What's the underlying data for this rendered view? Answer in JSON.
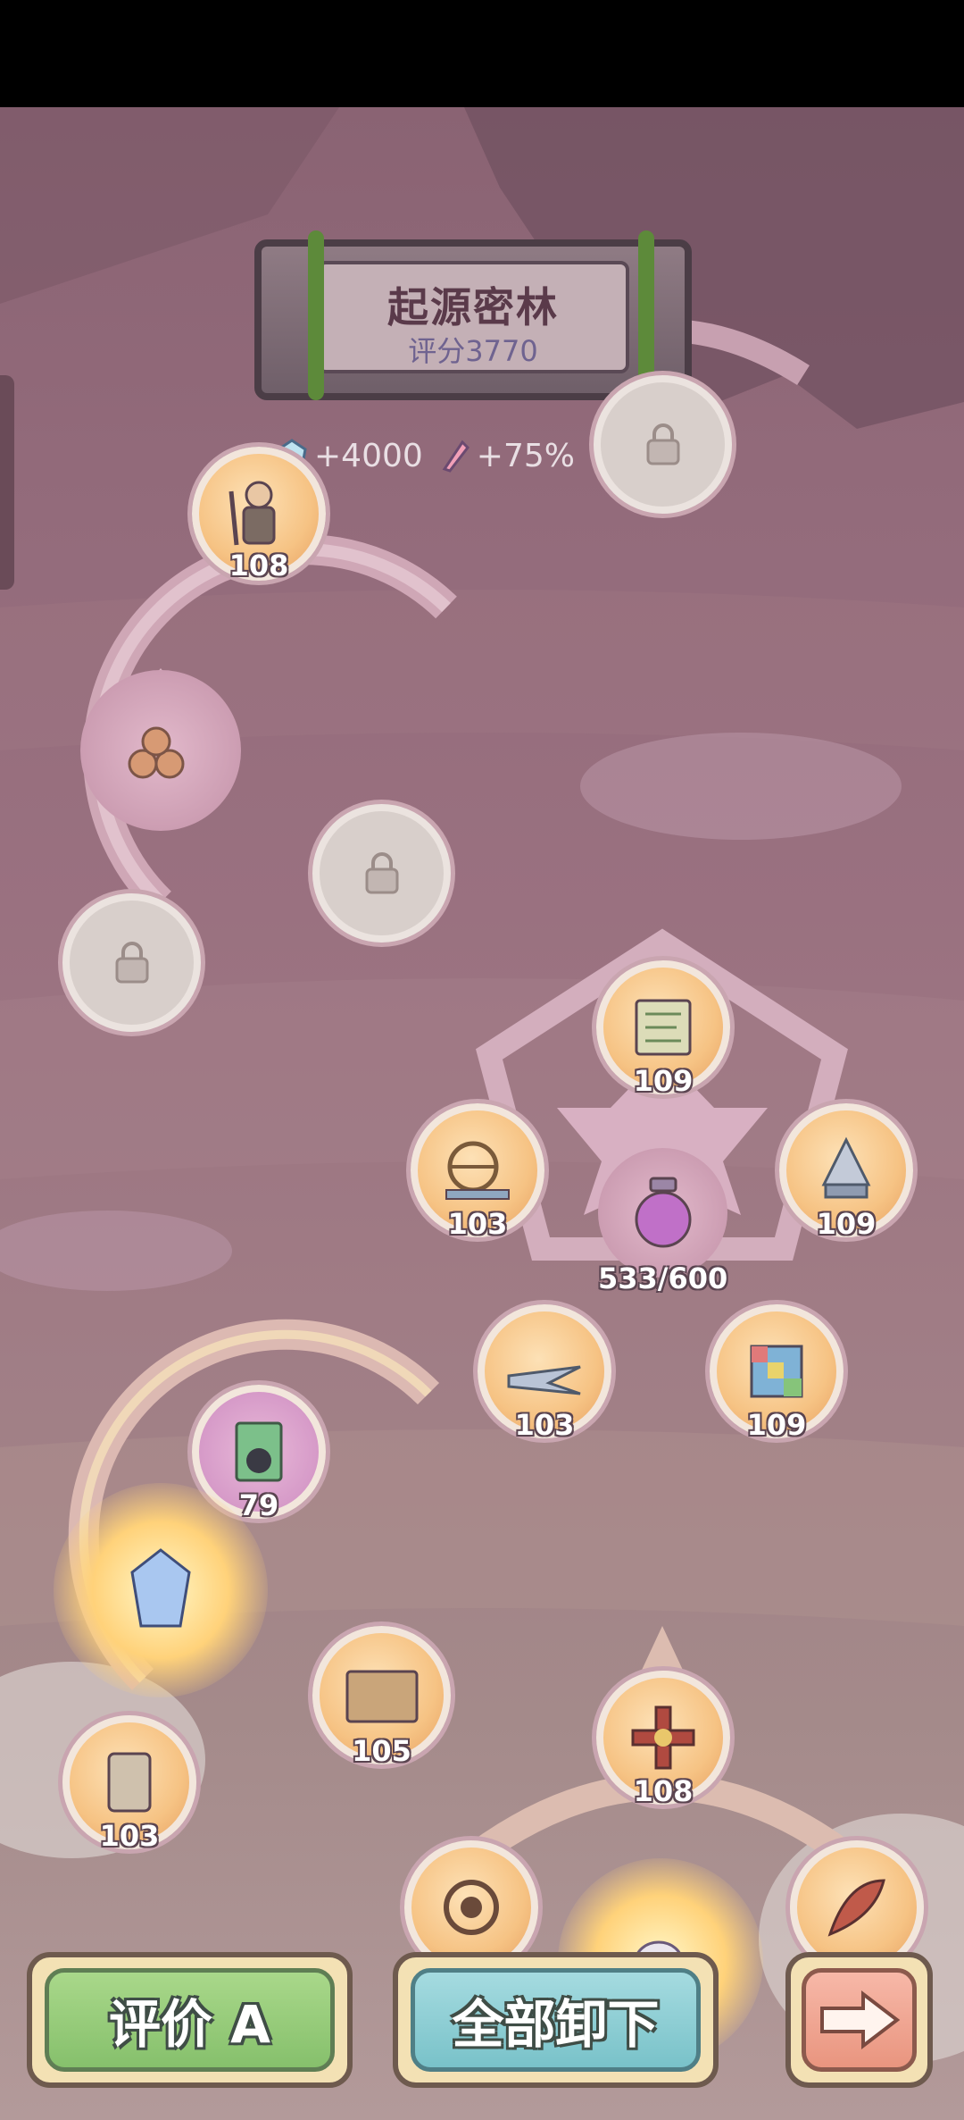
{
  "area": {
    "title": "起源密林",
    "score_text": "评分3770"
  },
  "bonuses": [
    {
      "icon": "gem-icon",
      "text": "+4000"
    },
    {
      "icon": "crystal-quill-icon",
      "text": "+75%"
    }
  ],
  "help_label": "?",
  "nodes": {
    "soldier": {
      "icon": "soldier-figure-icon",
      "level": "108"
    },
    "logs": {
      "icon": "logs-icon"
    },
    "lock_a": {
      "icon": "lock-icon"
    },
    "lock_b": {
      "icon": "lock-icon"
    },
    "lock_top": {
      "icon": "lock-icon"
    },
    "map_scroll": {
      "icon": "map-scroll-icon",
      "level": "109"
    },
    "armillary": {
      "icon": "armillary-sphere-icon",
      "level": "103"
    },
    "capsule": {
      "icon": "space-capsule-icon",
      "level": "109"
    },
    "potion": {
      "icon": "potion-jar-icon",
      "progress_text": "533/600"
    },
    "jet": {
      "icon": "fighter-jet-icon",
      "level": "103"
    },
    "cube": {
      "icon": "rubiks-cube-icon",
      "level": "109"
    },
    "catbook": {
      "icon": "cat-book-icon",
      "level": "79"
    },
    "rune_crystal": {
      "icon": "rune-crystal-icon"
    },
    "tablet": {
      "icon": "stone-tablet-icon",
      "level": "105"
    },
    "ancient_scroll": {
      "icon": "ancient-scroll-icon",
      "level": "103"
    },
    "cross": {
      "icon": "ornate-cross-icon",
      "level": "108"
    },
    "sun_disc": {
      "icon": "sun-disc-icon"
    },
    "bird_spirit": {
      "icon": "bird-spirit-icon"
    },
    "feather": {
      "icon": "feather-icon"
    }
  },
  "buttons": {
    "rate": "评价 A",
    "unload_all": "全部卸下",
    "next_icon": "arrow-right-icon"
  },
  "colors": {
    "unlocked_node": "#f6c384",
    "locked_node": "#d8cfcb",
    "rate_button": "#a9d88a",
    "unload_button": "#a5dbe0",
    "next_button": "#f7b8a8"
  }
}
